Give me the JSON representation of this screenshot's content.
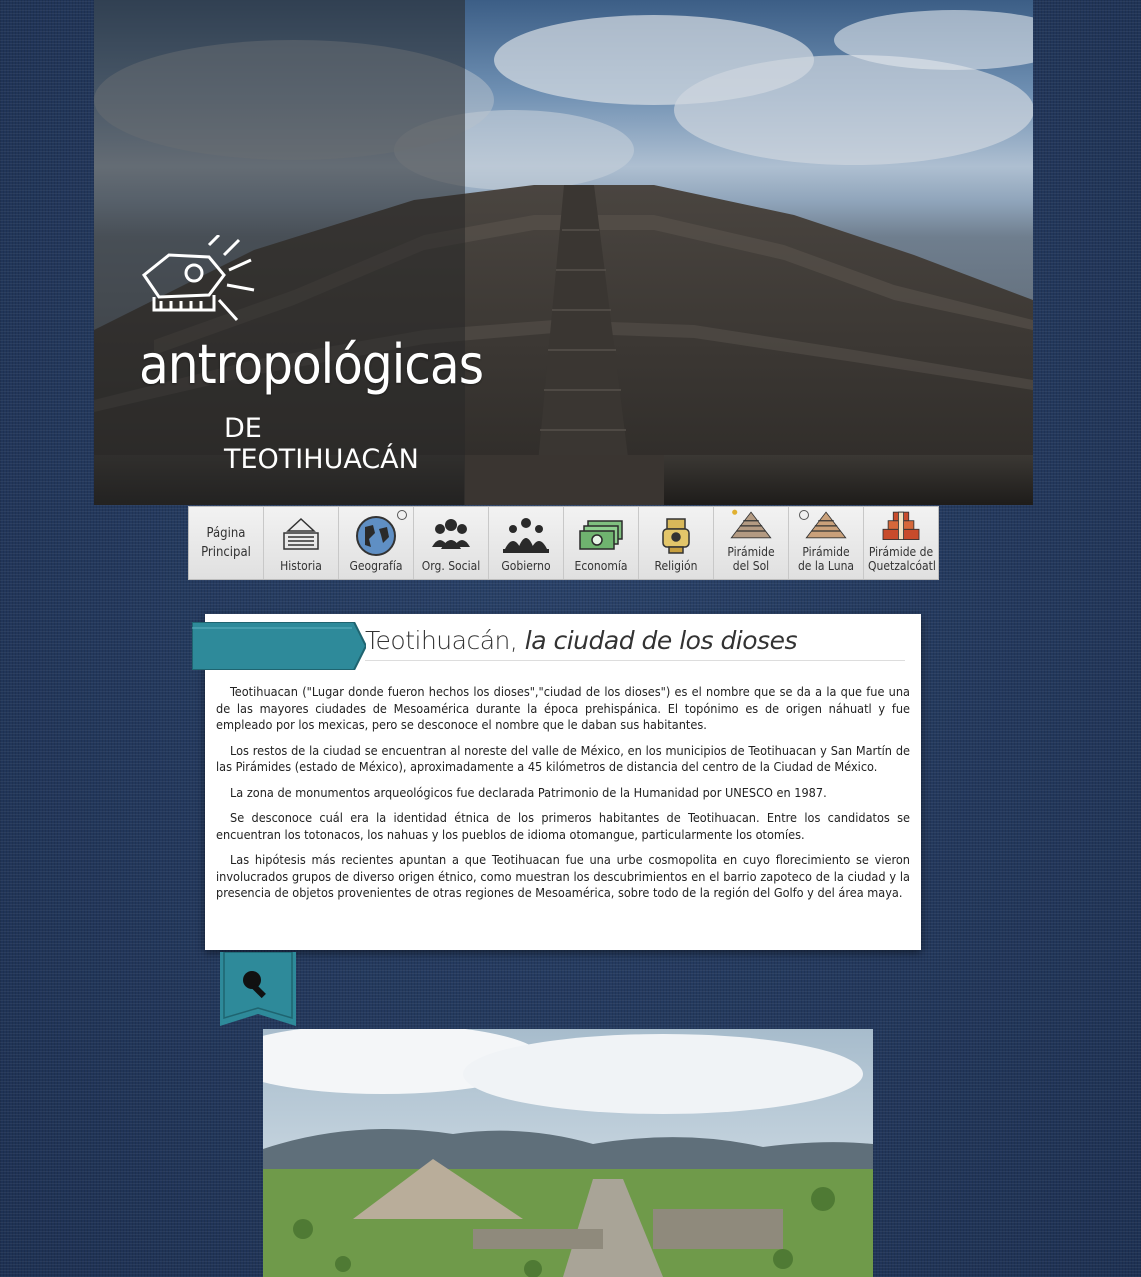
{
  "header": {
    "brand_title": "antropológicas",
    "brand_subtitle": "de Teotihuacán"
  },
  "nav": {
    "items": [
      {
        "label": "Página Principal",
        "icon": "home"
      },
      {
        "label": "Historia",
        "icon": "historia-icon"
      },
      {
        "label": "Geografía",
        "icon": "globe-icon"
      },
      {
        "label": "Org. Social",
        "icon": "people-icon"
      },
      {
        "label": "Gobierno",
        "icon": "government-icon"
      },
      {
        "label": "Economía",
        "icon": "money-icon"
      },
      {
        "label": "Religión",
        "icon": "religion-icon"
      },
      {
        "label": "Pirámide del Sol",
        "icon": "pyramid-sun-icon"
      },
      {
        "label": "Pirámide de la Luna",
        "icon": "pyramid-moon-icon"
      },
      {
        "label": "Pirámide de Quetzalcóatl",
        "icon": "pyramid-quetzalcoatl-icon"
      }
    ]
  },
  "article": {
    "title_main": "Teotihuacán,",
    "title_italic": " la ciudad de los dioses",
    "paragraphs": [
      "Teotihuacan (\"Lugar donde fueron hechos los dioses\",\"ciudad de los dioses\") es el nombre que se da a la que fue una de las mayores ciudades de Mesoamérica durante la época prehispánica. El topónimo es de origen náhuatl y fue empleado por los mexicas, pero se desconoce el nombre que le daban sus habitantes.",
      "Los restos de la ciudad se encuentran al noreste del valle de México, en los municipios de Teotihuacan y San Martín de las Pirámides (estado de México), aproximadamente a 45 kilómetros de distancia del centro de la Ciudad de México.",
      "La zona de monumentos arqueológicos fue declarada Patrimonio de la Humanidad por UNESCO en 1987.",
      "Se desconoce cuál era la identidad étnica de los primeros habitantes de Teotihuacan. Entre los candidatos se encuentran los totonacos, los nahuas y los pueblos de idioma otomangue, particularmente los otomíes.",
      "Las hipótesis más recientes apuntan a que Teotihuacan fue una urbe cosmopolita en cuyo florecimiento se vieron involucrados grupos de diverso origen étnico, como muestran los descubrimientos en el barrio zapoteco de la ciudad y la presencia de objetos provenientes de otras regiones de Mesoamérica, sobre todo de la región del Golfo y del área maya."
    ]
  },
  "colors": {
    "ribbon": "#2e8a9a",
    "background": "#22375a",
    "card": "#ffffff"
  }
}
